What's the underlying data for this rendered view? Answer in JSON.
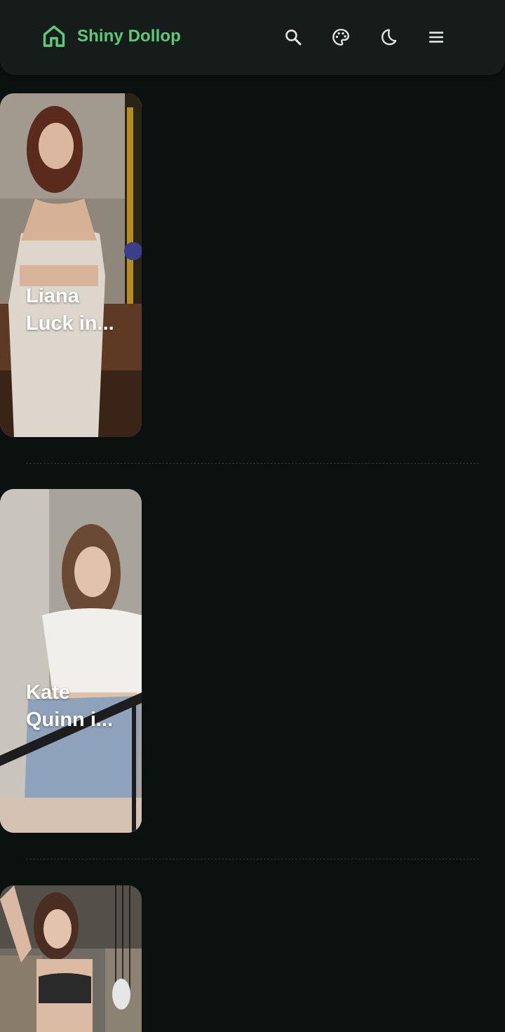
{
  "header": {
    "title": "Shiny Dollop",
    "brand_icon": "home-icon",
    "actions": [
      {
        "name": "search",
        "icon": "search-icon"
      },
      {
        "name": "theme",
        "icon": "palette-icon"
      },
      {
        "name": "dark-mode",
        "icon": "moon-icon"
      },
      {
        "name": "menu",
        "icon": "menu-icon"
      }
    ]
  },
  "colors": {
    "background": "#0b110f",
    "header_background": "#161c1a",
    "accent": "#5fc97a",
    "icon": "#e6e6e6"
  },
  "feed": {
    "items": [
      {
        "caption_line1": "Liana",
        "caption_line2": "Luck in..."
      },
      {
        "caption_line1": "Kate",
        "caption_line2": "Quinn i..."
      },
      {
        "caption_line1": "",
        "caption_line2": ""
      }
    ]
  }
}
